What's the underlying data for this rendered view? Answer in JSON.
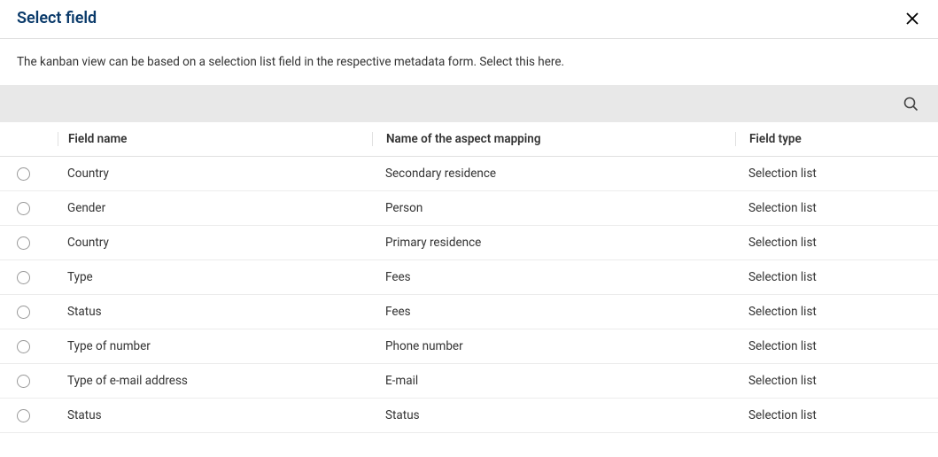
{
  "header": {
    "title": "Select field"
  },
  "description": "The kanban view can be based on a selection list field in the respective metadata form. Select this here.",
  "columns": {
    "fieldname": "Field name",
    "aspect": "Name of the aspect mapping",
    "fieldtype": "Field type"
  },
  "rows": [
    {
      "fieldname": "Country",
      "aspect": "Secondary residence",
      "fieldtype": "Selection list"
    },
    {
      "fieldname": "Gender",
      "aspect": "Person",
      "fieldtype": "Selection list"
    },
    {
      "fieldname": "Country",
      "aspect": "Primary residence",
      "fieldtype": "Selection list"
    },
    {
      "fieldname": "Type",
      "aspect": "Fees",
      "fieldtype": "Selection list"
    },
    {
      "fieldname": "Status",
      "aspect": "Fees",
      "fieldtype": "Selection list"
    },
    {
      "fieldname": "Type of number",
      "aspect": "Phone number",
      "fieldtype": "Selection list"
    },
    {
      "fieldname": "Type of e-mail address",
      "aspect": "E-mail",
      "fieldtype": "Selection list"
    },
    {
      "fieldname": "Status",
      "aspect": "Status",
      "fieldtype": "Selection list"
    }
  ]
}
